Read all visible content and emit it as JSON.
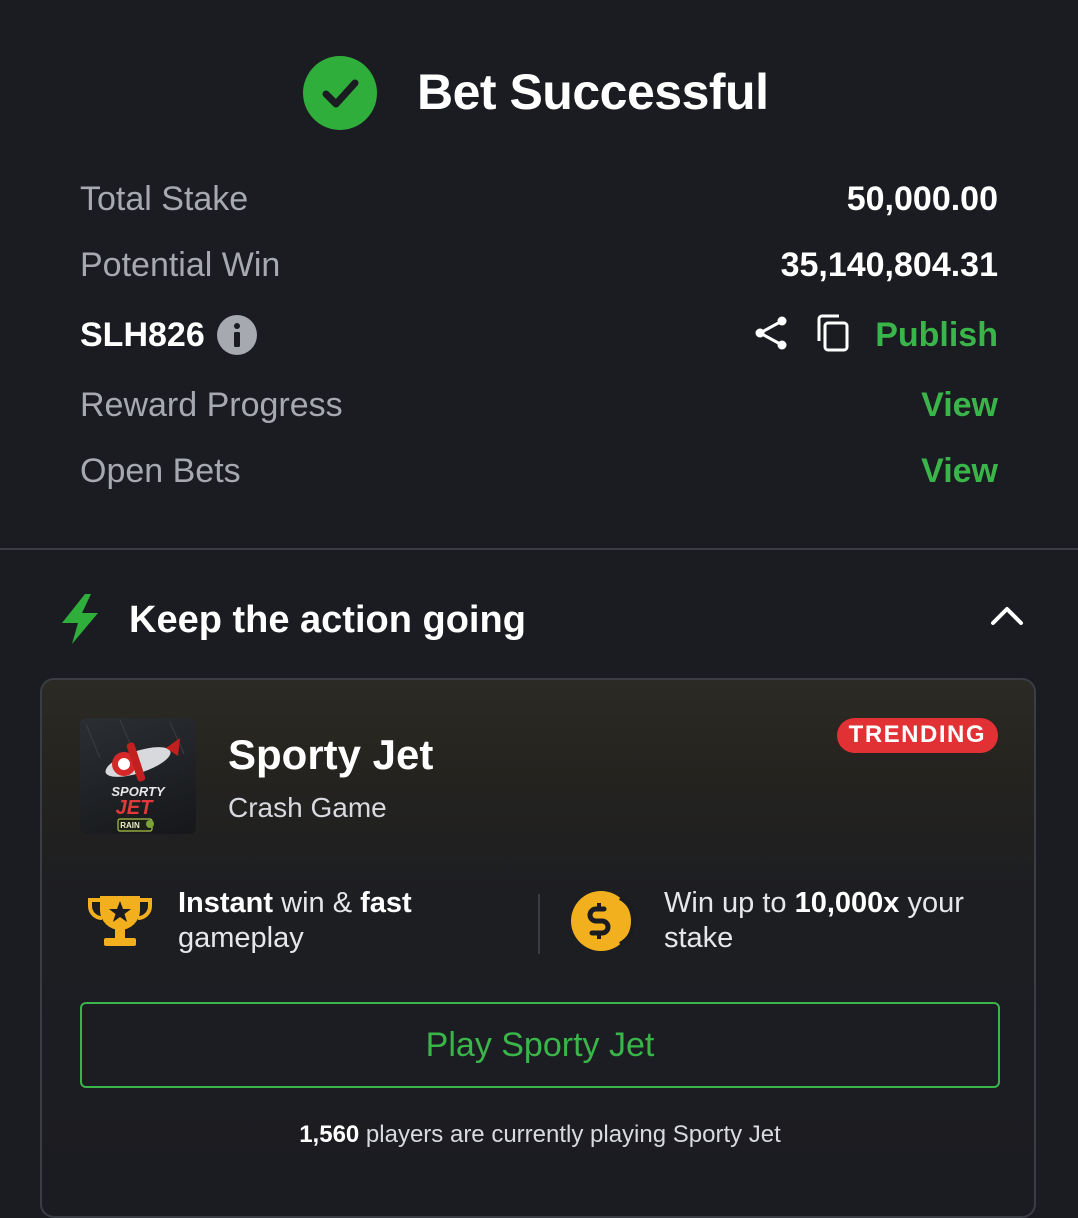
{
  "header": {
    "title": "Bet Successful",
    "icon": "check-circle-icon"
  },
  "summary": {
    "total_stake_label": "Total Stake",
    "total_stake_value": "50,000.00",
    "potential_win_label": "Potential Win",
    "potential_win_value": "35,140,804.31",
    "booking_code": "SLH826",
    "publish_label": "Publish",
    "reward_progress_label": "Reward Progress",
    "reward_progress_link": "View",
    "open_bets_label": "Open Bets",
    "open_bets_link": "View"
  },
  "promo": {
    "section_title": "Keep the action going",
    "game_name": "Sporty Jet",
    "game_type": "Crash Game",
    "badge": "TRENDING",
    "thumb_brand_line1": "SPORTY",
    "thumb_brand_line2": "JET",
    "thumb_tag": "RAIN",
    "feature1_bold1": "Instant",
    "feature1_mid": " win & ",
    "feature1_bold2": "fast",
    "feature1_tail": "gameplay",
    "feature2_pre": "Win up to ",
    "feature2_bold": "10,000x",
    "feature2_post": " your",
    "feature2_tail": "stake",
    "play_button": "Play Sporty Jet",
    "players_count": "1,560",
    "players_text": " players are currently playing Sporty Jet"
  },
  "colors": {
    "background": "#1b1c21",
    "accent_green": "#39b54a",
    "check_green": "#2fae3b",
    "badge_red": "#e13134",
    "muted_text": "#a7a9b1",
    "coin_gold": "#f2b01e"
  }
}
